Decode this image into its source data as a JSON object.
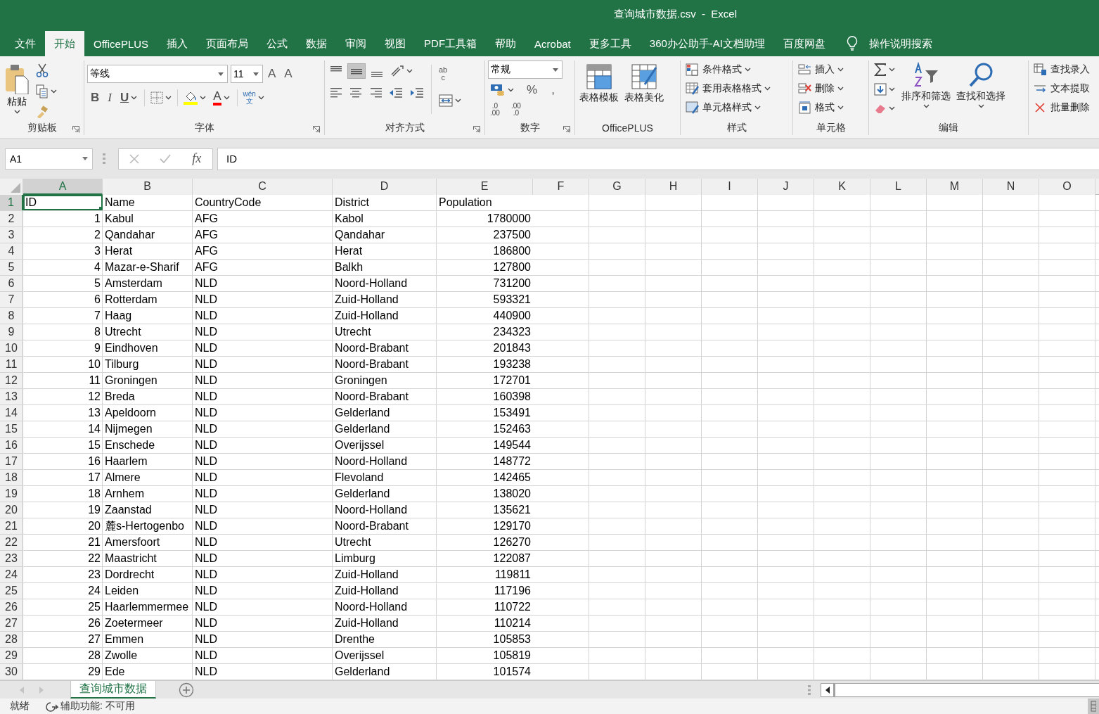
{
  "title_bar": {
    "title": "查询城市数据.csv  -  Excel"
  },
  "menu_tabs": [
    {
      "label": "文件",
      "selected": false
    },
    {
      "label": "开始",
      "selected": true
    },
    {
      "label": "OfficePLUS",
      "selected": false
    },
    {
      "label": "插入",
      "selected": false
    },
    {
      "label": "页面布局",
      "selected": false
    },
    {
      "label": "公式",
      "selected": false
    },
    {
      "label": "数据",
      "selected": false
    },
    {
      "label": "审阅",
      "selected": false
    },
    {
      "label": "视图",
      "selected": false
    },
    {
      "label": "PDF工具箱",
      "selected": false
    },
    {
      "label": "帮助",
      "selected": false
    },
    {
      "label": "Acrobat",
      "selected": false
    },
    {
      "label": "更多工具",
      "selected": false
    },
    {
      "label": "360办公助手-AI文档助理",
      "selected": false
    },
    {
      "label": "百度网盘",
      "selected": false
    }
  ],
  "tell_me": {
    "label": "操作说明搜索"
  },
  "ribbon": {
    "clipboard": {
      "label": "剪贴板",
      "paste": "粘贴"
    },
    "font": {
      "label": "字体",
      "font_name": "等线",
      "font_size": "11",
      "grow": "A",
      "shrink": "A",
      "bold": "B",
      "italic": "I",
      "underline": "U",
      "font_color": "A",
      "phonetic": "wén\n文"
    },
    "alignment": {
      "label": "对齐方式",
      "wrap": "ab\nc"
    },
    "number": {
      "label": "数字",
      "format": "常规",
      "percent": "%",
      "comma": ",",
      "increase_decimal": ".0\n.00",
      "decrease_decimal": ".00\n.0"
    },
    "officeplus": {
      "label": "OfficePLUS",
      "buttons": [
        "表格模板",
        "表格美化"
      ]
    },
    "styles": {
      "label": "样式",
      "buttons": [
        "条件格式",
        "套用表格格式",
        "单元格样式"
      ]
    },
    "cells": {
      "label": "单元格",
      "buttons": [
        "插入",
        "删除",
        "格式"
      ]
    },
    "editing": {
      "label": "编辑",
      "buttons": [
        "排序和筛选",
        "查找和选择"
      ]
    },
    "extra": {
      "buttons": [
        "查找录入",
        "文本提取",
        "批量删除"
      ]
    }
  },
  "formula_bar": {
    "name_box": "A1",
    "function_label": "fx",
    "formula": "ID"
  },
  "sheet": {
    "columns": [
      {
        "label": "A",
        "selected": true
      },
      {
        "label": "B",
        "selected": false
      },
      {
        "label": "C",
        "selected": false
      },
      {
        "label": "D",
        "selected": false
      },
      {
        "label": "E",
        "selected": false
      },
      {
        "label": "F",
        "selected": false
      },
      {
        "label": "G",
        "selected": false
      },
      {
        "label": "H",
        "selected": false
      },
      {
        "label": "I",
        "selected": false
      },
      {
        "label": "J",
        "selected": false
      },
      {
        "label": "K",
        "selected": false
      },
      {
        "label": "L",
        "selected": false
      },
      {
        "label": "M",
        "selected": false
      },
      {
        "label": "N",
        "selected": false
      },
      {
        "label": "O",
        "selected": false
      }
    ],
    "rows": [
      {
        "number": "1",
        "selected": true,
        "cells": [
          "ID",
          "Name",
          "CountryCode",
          "District",
          "Population"
        ]
      },
      {
        "number": "2",
        "selected": false,
        "cells": [
          "1",
          "Kabul",
          "AFG",
          "Kabol",
          "1780000"
        ]
      },
      {
        "number": "3",
        "selected": false,
        "cells": [
          "2",
          "Qandahar",
          "AFG",
          "Qandahar",
          "237500"
        ]
      },
      {
        "number": "4",
        "selected": false,
        "cells": [
          "3",
          "Herat",
          "AFG",
          "Herat",
          "186800"
        ]
      },
      {
        "number": "5",
        "selected": false,
        "cells": [
          "4",
          "Mazar-e-Sharif",
          "AFG",
          "Balkh",
          "127800"
        ]
      },
      {
        "number": "6",
        "selected": false,
        "cells": [
          "5",
          "Amsterdam",
          "NLD",
          "Noord-Holland",
          "731200"
        ]
      },
      {
        "number": "7",
        "selected": false,
        "cells": [
          "6",
          "Rotterdam",
          "NLD",
          "Zuid-Holland",
          "593321"
        ]
      },
      {
        "number": "8",
        "selected": false,
        "cells": [
          "7",
          "Haag",
          "NLD",
          "Zuid-Holland",
          "440900"
        ]
      },
      {
        "number": "9",
        "selected": false,
        "cells": [
          "8",
          "Utrecht",
          "NLD",
          "Utrecht",
          "234323"
        ]
      },
      {
        "number": "10",
        "selected": false,
        "cells": [
          "9",
          "Eindhoven",
          "NLD",
          "Noord-Brabant",
          "201843"
        ]
      },
      {
        "number": "11",
        "selected": false,
        "cells": [
          "10",
          "Tilburg",
          "NLD",
          "Noord-Brabant",
          "193238"
        ]
      },
      {
        "number": "12",
        "selected": false,
        "cells": [
          "11",
          "Groningen",
          "NLD",
          "Groningen",
          "172701"
        ]
      },
      {
        "number": "13",
        "selected": false,
        "cells": [
          "12",
          "Breda",
          "NLD",
          "Noord-Brabant",
          "160398"
        ]
      },
      {
        "number": "14",
        "selected": false,
        "cells": [
          "13",
          "Apeldoorn",
          "NLD",
          "Gelderland",
          "153491"
        ]
      },
      {
        "number": "15",
        "selected": false,
        "cells": [
          "14",
          "Nijmegen",
          "NLD",
          "Gelderland",
          "152463"
        ]
      },
      {
        "number": "16",
        "selected": false,
        "cells": [
          "15",
          "Enschede",
          "NLD",
          "Overijssel",
          "149544"
        ]
      },
      {
        "number": "17",
        "selected": false,
        "cells": [
          "16",
          "Haarlem",
          "NLD",
          "Noord-Holland",
          "148772"
        ]
      },
      {
        "number": "18",
        "selected": false,
        "cells": [
          "17",
          "Almere",
          "NLD",
          "Flevoland",
          "142465"
        ]
      },
      {
        "number": "19",
        "selected": false,
        "cells": [
          "18",
          "Arnhem",
          "NLD",
          "Gelderland",
          "138020"
        ]
      },
      {
        "number": "20",
        "selected": false,
        "cells": [
          "19",
          "Zaanstad",
          "NLD",
          "Noord-Holland",
          "135621"
        ]
      },
      {
        "number": "21",
        "selected": false,
        "cells": [
          "20",
          "麓s-Hertogenbo",
          "NLD",
          "Noord-Brabant",
          "129170"
        ]
      },
      {
        "number": "22",
        "selected": false,
        "cells": [
          "21",
          "Amersfoort",
          "NLD",
          "Utrecht",
          "126270"
        ]
      },
      {
        "number": "23",
        "selected": false,
        "cells": [
          "22",
          "Maastricht",
          "NLD",
          "Limburg",
          "122087"
        ]
      },
      {
        "number": "24",
        "selected": false,
        "cells": [
          "23",
          "Dordrecht",
          "NLD",
          "Zuid-Holland",
          "119811"
        ]
      },
      {
        "number": "25",
        "selected": false,
        "cells": [
          "24",
          "Leiden",
          "NLD",
          "Zuid-Holland",
          "117196"
        ]
      },
      {
        "number": "26",
        "selected": false,
        "cells": [
          "25",
          "Haarlemmermee",
          "NLD",
          "Noord-Holland",
          "110722"
        ]
      },
      {
        "number": "27",
        "selected": false,
        "cells": [
          "26",
          "Zoetermeer",
          "NLD",
          "Zuid-Holland",
          "110214"
        ]
      },
      {
        "number": "28",
        "selected": false,
        "cells": [
          "27",
          "Emmen",
          "NLD",
          "Drenthe",
          "105853"
        ]
      },
      {
        "number": "29",
        "selected": false,
        "cells": [
          "28",
          "Zwolle",
          "NLD",
          "Overijssel",
          "105819"
        ]
      },
      {
        "number": "30",
        "selected": false,
        "cells": [
          "29",
          "Ede",
          "NLD",
          "Gelderland",
          "101574"
        ]
      }
    ]
  },
  "sheet_tabs": [
    {
      "label": "查询城市数据",
      "selected": true
    }
  ],
  "status_bar": {
    "status": "就绪",
    "accessibility": "辅助功能: 不可用"
  }
}
